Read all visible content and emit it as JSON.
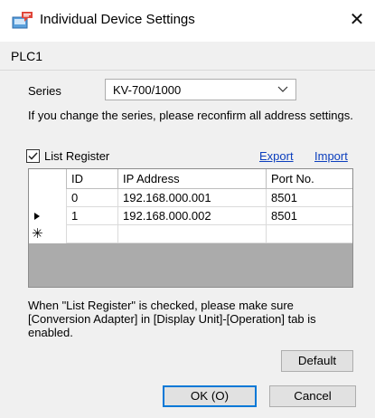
{
  "window": {
    "title": "Individual Device Settings",
    "close_glyph": "✕",
    "icon": "device-settings-icon"
  },
  "device": {
    "name": "PLC1"
  },
  "series": {
    "label": "Series",
    "value": "KV-700/1000",
    "warning": "If you change the series, please reconfirm all address settings."
  },
  "list_register": {
    "label": "List Register",
    "checked": true,
    "export_label": "Export",
    "import_label": "Import"
  },
  "table": {
    "columns": [
      "ID",
      "IP Address",
      "Port No."
    ],
    "rows": [
      {
        "id": "0",
        "ip": "192.168.000.001",
        "port": "8501",
        "marker": ""
      },
      {
        "id": "1",
        "ip": "192.168.000.002",
        "port": "8501",
        "marker": "current-row-arrow-icon"
      }
    ],
    "new_row_glyph": "✳"
  },
  "note": "When \"List Register\" is checked, please make sure [Conversion Adapter] in [Display Unit]-[Operation] tab is enabled.",
  "buttons": {
    "default": "Default",
    "ok": "OK (O)",
    "cancel": "Cancel"
  }
}
